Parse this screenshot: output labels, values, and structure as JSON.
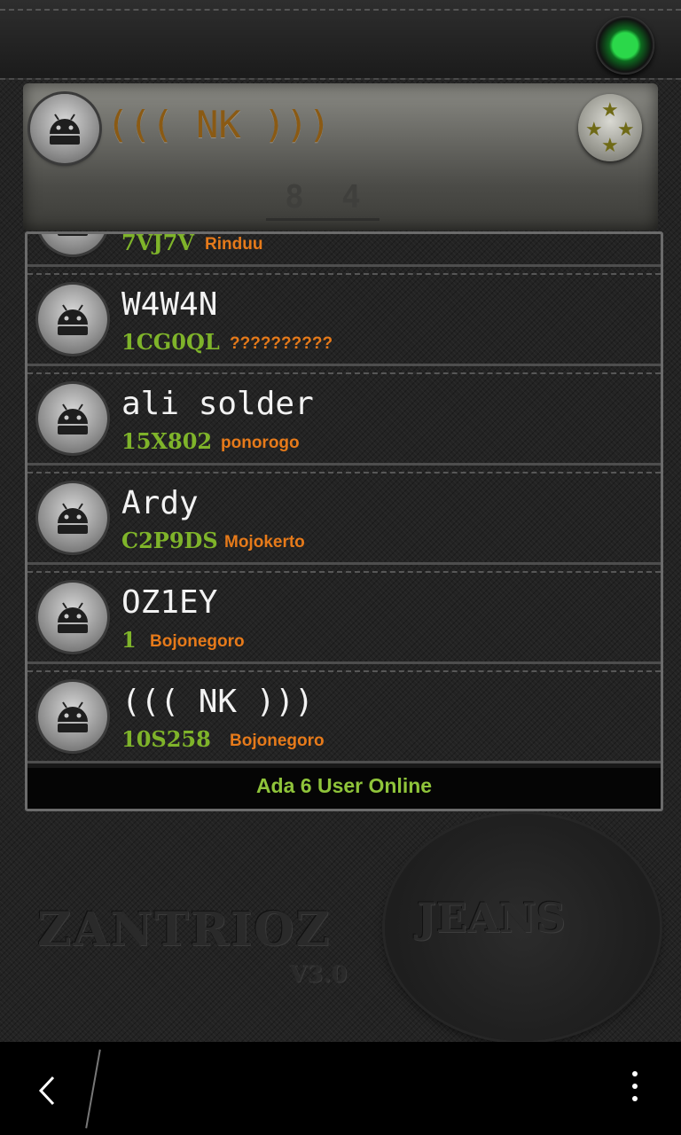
{
  "header": {
    "title": "((( NK )))",
    "counter_digits": [
      "8",
      "4"
    ]
  },
  "users": [
    {
      "name": "",
      "code": "7VJ7V",
      "city": "Rinduu"
    },
    {
      "name": "W4W4N",
      "code": "1CG0QL",
      "city": "??????????"
    },
    {
      "name": "ali solder",
      "code": "15X802",
      "city": "ponorogo"
    },
    {
      "name": "Ardy",
      "code": "C2P9DS",
      "city": "Mojokerto"
    },
    {
      "name": "OZ1EY",
      "code": "1",
      "city": "Bojonegoro"
    },
    {
      "name": "((( NK )))",
      "code": "10S258",
      "city": "Bojonegoro"
    }
  ],
  "online_text": "Ada 6 User Online",
  "branding": {
    "name": "ZANTRIOZ",
    "version": "V3.0",
    "badge": "JEANS"
  },
  "icons": {
    "avatar": "android-robot-icon",
    "status": "green-status-led-icon",
    "badge": "stars-badge-icon",
    "back": "back-arrow-icon",
    "menu": "overflow-menu-icon"
  },
  "colors": {
    "username": "#f2f2f2",
    "code": "#7fb42a",
    "city": "#e67a1a",
    "online": "#8fc43a",
    "title": "#8a5a14"
  }
}
